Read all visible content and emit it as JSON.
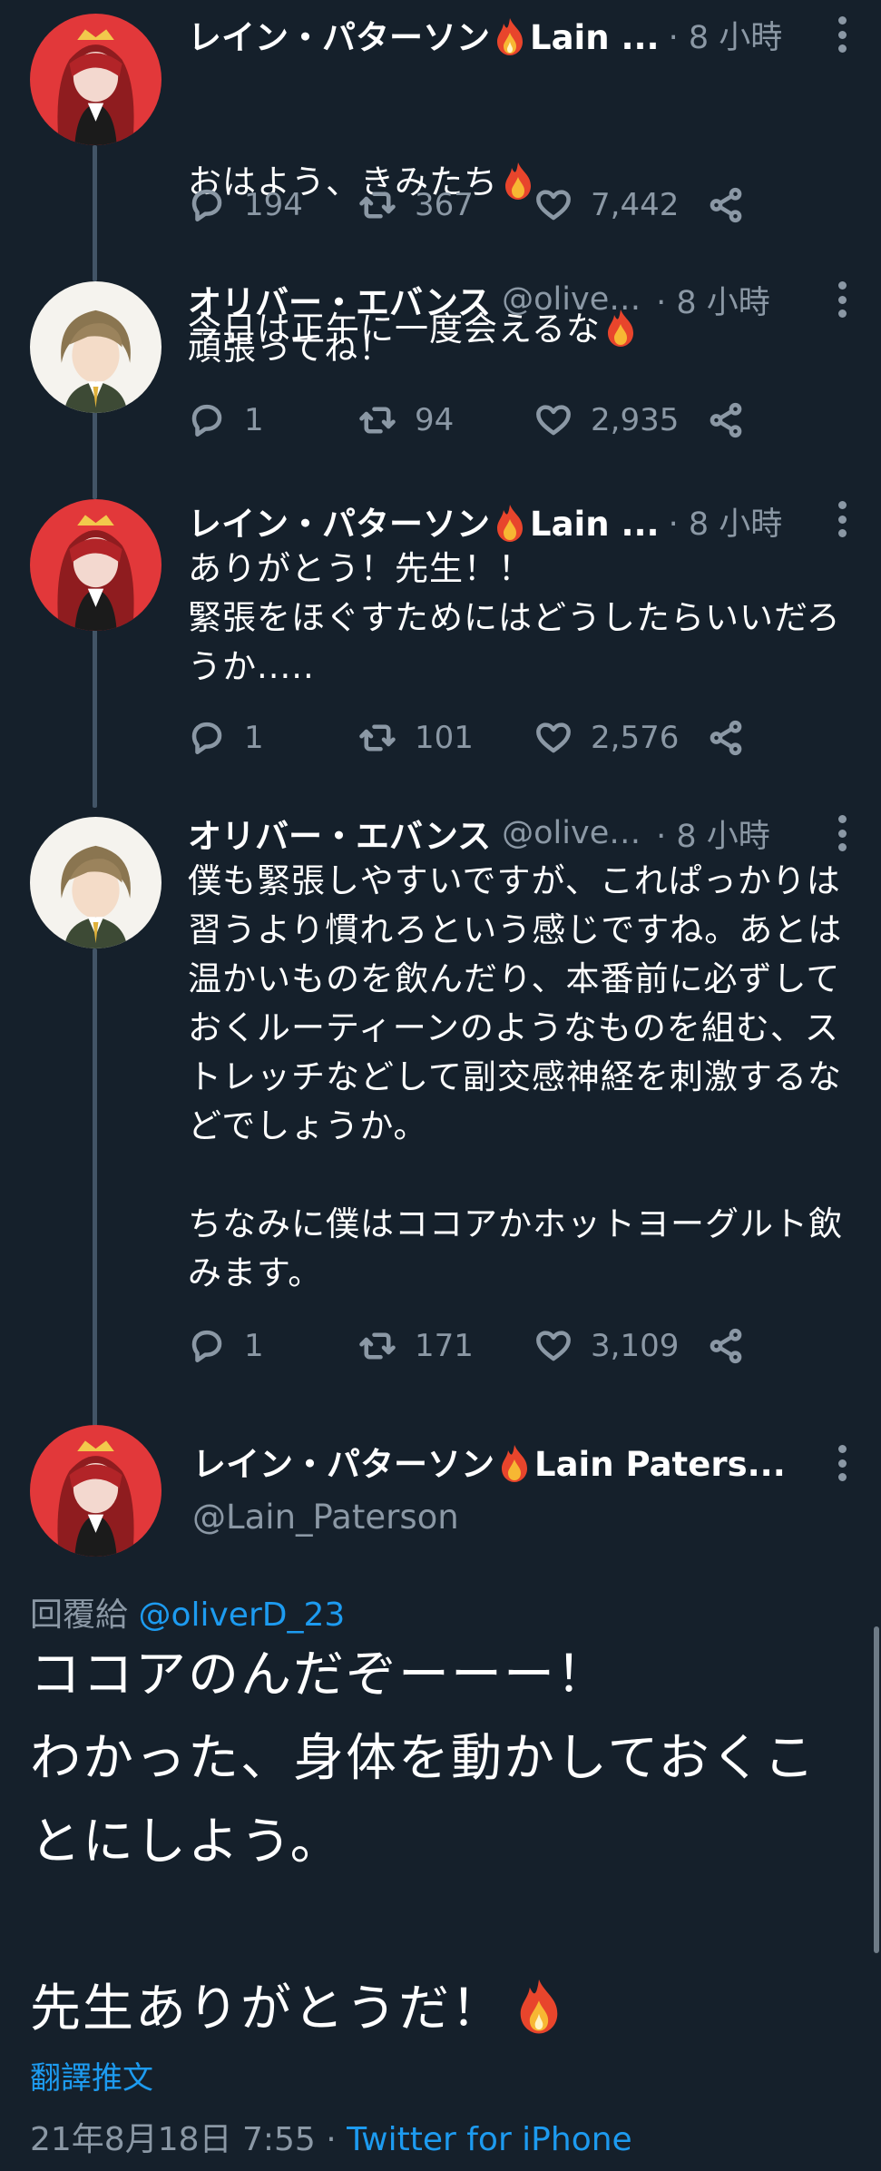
{
  "thread": [
    {
      "name": "レイン・パターソン",
      "name_suffix": "Lain ...",
      "handle": "",
      "time": "· 8 小時",
      "body_lines": [
        "おはよう、きみたち",
        "今日は正午に一度会えるな"
      ],
      "replies": "194",
      "retweets": "367",
      "likes": "7,442"
    },
    {
      "name": "オリバー・エバンス",
      "name_suffix": "",
      "handle": "@oliver...",
      "time": "· 8 小時",
      "body": "頑張ってね！",
      "replies": "1",
      "retweets": "94",
      "likes": "2,935"
    },
    {
      "name": "レイン・パターソン",
      "name_suffix": "Lain ...",
      "handle": "",
      "time": "· 8 小時",
      "body": "ありがとう！先生！！\n緊張をほぐすためにはどうしたらいいだろうか.....",
      "replies": "1",
      "retweets": "101",
      "likes": "2,576"
    },
    {
      "name": "オリバー・エバンス",
      "name_suffix": "",
      "handle": "@oliver...",
      "time": "· 8 小時",
      "body": "僕も緊張しやすいですが、これぱっかりは習うより慣れろという感じですね。あとは温かいものを飲んだり、本番前に必ずしておくルーティーンのようなものを組む、ストレッチなどして副交感神経を刺激するなどでしょうか。\n\nちなみに僕はココアかホットヨーグルト飲みます。",
      "replies": "1",
      "retweets": "171",
      "likes": "3,109"
    }
  ],
  "main_tweet": {
    "name": "レイン・パターソン",
    "name_suffix": "Lain Paters...",
    "handle": "@Lain_Paterson",
    "reply_prefix": "回覆給",
    "reply_to": "@oliverD_23",
    "body_main": "ココアのんだぞーーー！\nわかった、身体を動かしておくことにしよう。\n\n先生ありがとうだ！",
    "translate_label": "翻譯推文",
    "date": "21年8月18日 7:55 · ",
    "source": "Twitter for iPhone"
  },
  "icons": {
    "reply": "reply-icon",
    "retweet": "retweet-icon",
    "like": "heart-icon",
    "share": "share-icon",
    "more": "more-icon",
    "fire": "fire-emoji-icon"
  },
  "colors": {
    "background": "#15202b",
    "text": "#ffffff",
    "secondary": "#8b98a5",
    "link": "#1d9bf0",
    "thread_line": "#425466"
  }
}
